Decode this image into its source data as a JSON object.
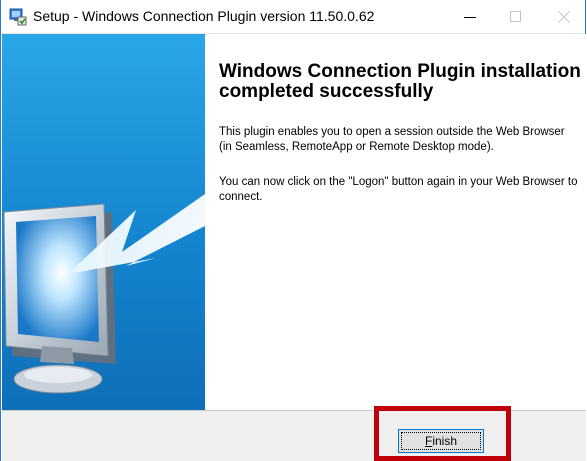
{
  "window": {
    "title": "Setup - Windows Connection Plugin version 11.50.0.62",
    "icons": [
      "setup-app-icon",
      "minimize-icon",
      "maximize-icon",
      "close-icon"
    ]
  },
  "side_panel": {
    "image": "monitor-with-arrow-illustration"
  },
  "content": {
    "heading": "Windows Connection Plugin installation completed successfully",
    "paragraph1": "This plugin enables you to open a session outside the Web Browser (in Seamless, RemoteApp or Remote Desktop mode).",
    "paragraph2": "You can now click on the \"Logon\" button again in your Web Browser to connect."
  },
  "footer": {
    "finish_mnemonic": "F",
    "finish_rest": "inish"
  },
  "colors": {
    "highlight": "#c0000b",
    "panel_top": "#2aa6e6",
    "panel_bottom": "#0e6fb8",
    "button_focus": "#0078d7"
  }
}
